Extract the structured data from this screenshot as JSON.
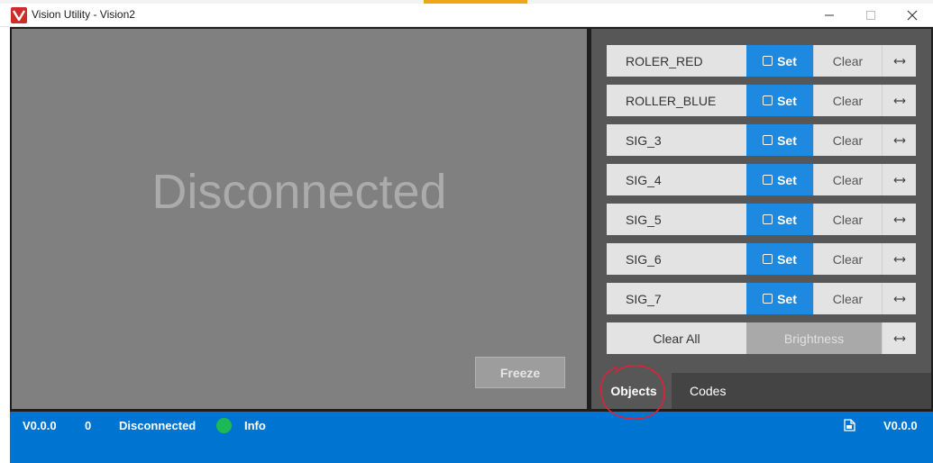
{
  "window": {
    "title": "Vision Utility - Vision2",
    "icon": "vex-logo-icon"
  },
  "video": {
    "status_text": "Disconnected",
    "freeze_label": "Freeze"
  },
  "signatures": [
    {
      "name": "ROLER_RED",
      "set_label": "Set",
      "clear_label": "Clear"
    },
    {
      "name": "ROLLER_BLUE",
      "set_label": "Set",
      "clear_label": "Clear"
    },
    {
      "name": "SIG_3",
      "set_label": "Set",
      "clear_label": "Clear"
    },
    {
      "name": "SIG_4",
      "set_label": "Set",
      "clear_label": "Clear"
    },
    {
      "name": "SIG_5",
      "set_label": "Set",
      "clear_label": "Clear"
    },
    {
      "name": "SIG_6",
      "set_label": "Set",
      "clear_label": "Clear"
    },
    {
      "name": "SIG_7",
      "set_label": "Set",
      "clear_label": "Clear"
    }
  ],
  "controls": {
    "clear_all_label": "Clear All",
    "brightness_label": "Brightness"
  },
  "tabs": [
    {
      "label": "Objects",
      "active": true
    },
    {
      "label": "Codes",
      "active": false
    }
  ],
  "status": {
    "version_left": "V0.0.0",
    "count": "0",
    "connection": "Disconnected",
    "indicator_color": "#1db954",
    "info_label": "Info",
    "version_right": "V0.0.0"
  },
  "colors": {
    "accent_blue": "#1d89e0",
    "status_bar": "#0074d1",
    "annotation_red": "#e0203a"
  }
}
